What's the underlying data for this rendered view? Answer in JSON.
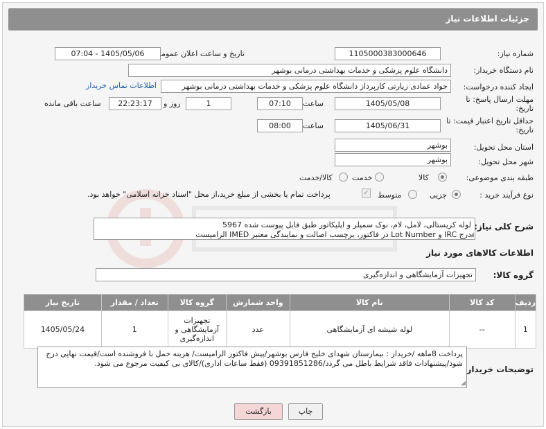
{
  "header": {
    "title": "جزئیات اطلاعات نیاز"
  },
  "form": {
    "need_number": {
      "label": "شماره نیاز:",
      "value": "1105000383000646"
    },
    "announce_datetime": {
      "label": "تاریخ و ساعت اعلان عمومی:",
      "value": "1405/05/06 - 07:04"
    },
    "buyer_org": {
      "label": "نام دستگاه خریدار:",
      "value": "دانشگاه علوم پزشکی و خدمات بهداشتی درمانی بوشهر"
    },
    "requester": {
      "label": "ایجاد کننده درخواست:",
      "value": "جواد عمادی زیارتی کارپرداز دانشگاه علوم پزشکی و خدمات بهداشتی درمانی بوشهر",
      "contact_link": "اطلاعات تماس خریدار"
    },
    "deadline": {
      "label": "مهلت ارسال پاسخ: تا تاریخ:",
      "date": "1405/05/08",
      "time_label": "ساعت",
      "time": "07:10",
      "days": "1",
      "days_label": "روز و",
      "remaining": "22:23:17",
      "remaining_label": "ساعت باقی مانده"
    },
    "price_validity": {
      "label": "حداقل تاریخ اعتبار قیمت: تا تاریخ:",
      "date": "1405/06/31",
      "time_label": "ساعت",
      "time": "08:00"
    },
    "delivery_province": {
      "label": "استان محل تحویل:",
      "value": "بوشهر"
    },
    "delivery_city": {
      "label": "شهر محل تحویل:",
      "value": "بوشهر"
    },
    "category": {
      "label": "طبقه بندی موضوعی:",
      "options": [
        "کالا",
        "خدمت",
        "کالا/خدمت"
      ],
      "selected": "کالا"
    },
    "process_type": {
      "label": "نوع فرآیند خرید :",
      "options": [
        "جزیی",
        "متوسط"
      ],
      "selected": "جزیی",
      "payment_note": "پرداخت تمام یا بخشی از مبلغ خرید،از محل \"اسناد خزانه اسلامی\" خواهد بود."
    }
  },
  "description": {
    "label": "شرح کلی نیاز:",
    "line1": "لوله کریستالی، لامل، لام، نوک سمپلر و اپلیکاتور طبق فایل پیوست شده 5967",
    "line2": "درج IRC و Lot Number در فاکتور، برچسب اصالت و نمایندگی معتبر IMED الزامیست"
  },
  "goods_info": {
    "title": "اطلاعات کالاهای مورد نیاز"
  },
  "goods_group": {
    "label": "گروه کالا:",
    "value": "تجهیزات آزمایشگاهی و اندازه‌گیری"
  },
  "table": {
    "headers": [
      "ردیف",
      "کد کالا",
      "نام کالا",
      "واحد شمارش",
      "گروه کالا",
      "تعداد / مقدار",
      "تاریخ نیاز"
    ],
    "rows": [
      {
        "row": "1",
        "code": "--",
        "name": "لوله شیشه ای آزمایشگاهی",
        "unit": "عدد",
        "group": "تجهیزات آزمایشگاهی و اندازه‌گیری",
        "qty": "1",
        "date": "1405/05/24"
      }
    ]
  },
  "buyer_notes": {
    "label": "توضیحات خریدار:",
    "text": "پرداخت 8ماهه /خریدار : بیمارستان شهدای خلیج فارس بوشهر/پیش فاکتور الزامیست/ هزینه حمل با فروشنده است/قیمت نهایی درج شود/پیشنهادات فاقد شرایط باطل می گردد/09391851286 (فقط ساعات اداری)/کالای بی کیفیت مرجوع می شود."
  },
  "buttons": {
    "print": "چاپ",
    "back": "بازگشت"
  },
  "colors": {
    "header_bg": "#8f8f8f",
    "link": "#1f5fb0",
    "back_button": "#f4d6d6"
  }
}
